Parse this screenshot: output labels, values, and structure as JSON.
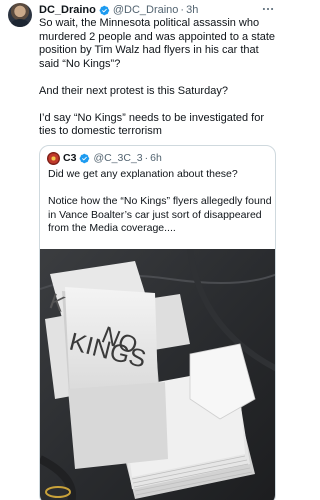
{
  "tweet": {
    "author_name": "DC_Draino",
    "author_handle": "@DC_Draino",
    "separator": "·",
    "time": "3h",
    "more_icon": "ellipsis-icon",
    "verified_icon": "verified-badge-icon",
    "paragraphs": [
      "So wait, the Minnesota political assassin who murdered 2 people and was appointed to a state position by Tim Walz had flyers in his car that said “No Kings”?",
      "And their next protest is this Saturday?",
      "I’d say “No Kings” needs to be investigated for ties to domestic terrorism"
    ]
  },
  "quote": {
    "author_name": "C3",
    "author_handle": "@C_3C_3",
    "separator": "·",
    "time": "6h",
    "paragraphs": [
      "Did we get any explanation about these?",
      "Notice how the “No Kings” flyers allegedly found in Vance Boalter’s car just sort of disappeared from the Media coverage...."
    ],
    "image": {
      "flyer_text_top": "NO",
      "flyer_text_bottom": "KINGS",
      "flyer_text_side": "K"
    }
  },
  "colors": {
    "text_primary": "#0f1419",
    "text_secondary": "#536471",
    "verified_blue": "#1d9bf0",
    "border": "#cfd9de"
  }
}
